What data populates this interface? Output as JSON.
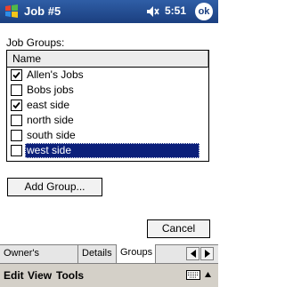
{
  "titlebar": {
    "title": "Job #5",
    "time": "5:51",
    "ok_label": "ok"
  },
  "groups_label": "Job Groups:",
  "list": {
    "column_header": "Name",
    "rows": [
      {
        "label": "Allen's Jobs",
        "checked": true,
        "selected": false
      },
      {
        "label": "Bobs jobs",
        "checked": false,
        "selected": false
      },
      {
        "label": "east side",
        "checked": true,
        "selected": false
      },
      {
        "label": "north side",
        "checked": false,
        "selected": false
      },
      {
        "label": "south side",
        "checked": false,
        "selected": false
      },
      {
        "label": "west side",
        "checked": false,
        "selected": true
      }
    ]
  },
  "buttons": {
    "add_group": "Add Group...",
    "cancel": "Cancel"
  },
  "tabs": [
    {
      "label": "Owner's Phones",
      "active": false
    },
    {
      "label": "Details",
      "active": false
    },
    {
      "label": "Groups",
      "active": true
    }
  ],
  "menu": {
    "edit": "Edit",
    "view": "View",
    "tools": "Tools"
  },
  "colors": {
    "titlebar": "#1b3f80",
    "selection": "#0b1f7a"
  },
  "icons": {
    "start": "windows-flag-icon",
    "volume": "speaker-icon",
    "keyboard": "keyboard-icon"
  }
}
